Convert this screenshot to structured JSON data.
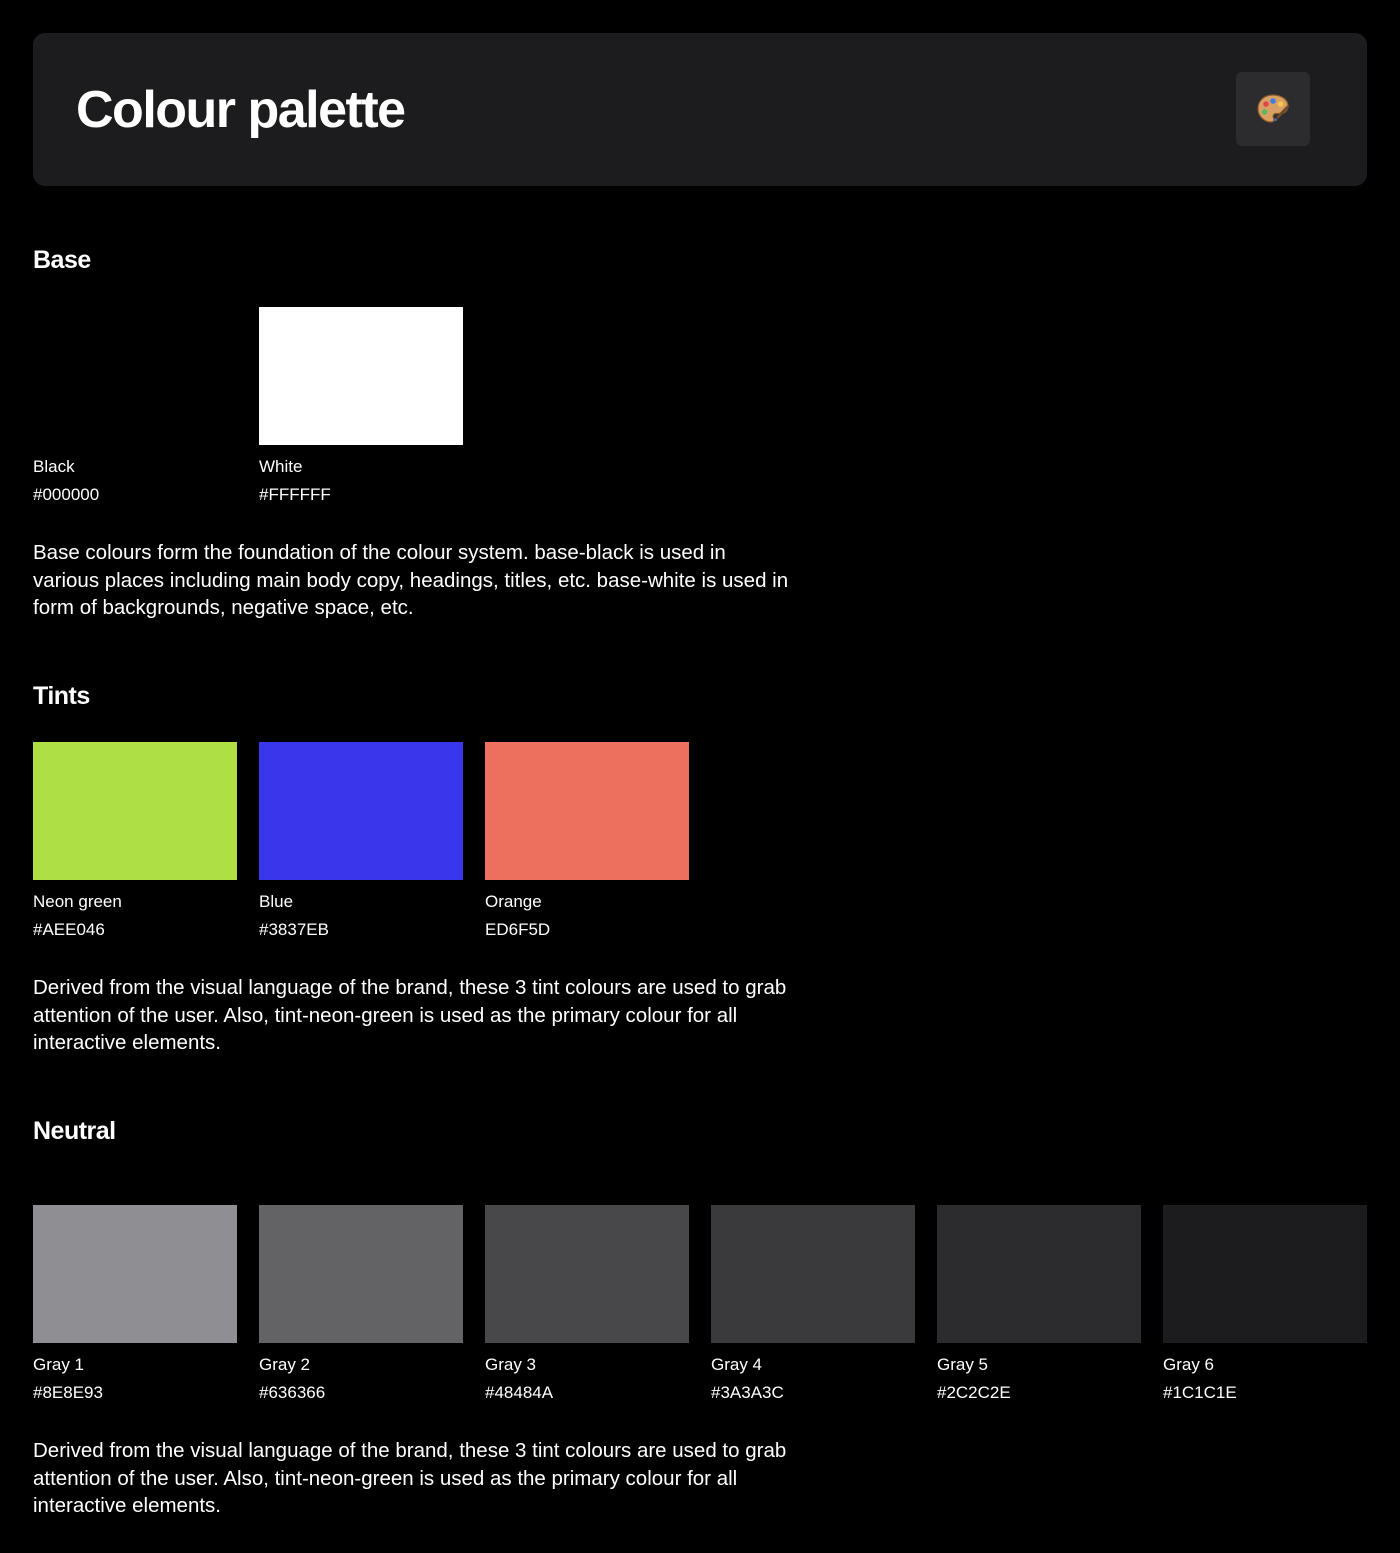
{
  "header": {
    "title": "Colour palette",
    "icon": "palette-icon"
  },
  "sections": {
    "base": {
      "title": "Base",
      "swatches": [
        {
          "name": "Black",
          "hex": "#000000",
          "color": "#000000"
        },
        {
          "name": "White",
          "hex": "#FFFFFF",
          "color": "#FFFFFF"
        }
      ],
      "description": "Base colours form the foundation of the colour system. base-black is used in various places including main body copy, headings, titles, etc. base-white is used in form of backgrounds, negative space, etc."
    },
    "tints": {
      "title": "Tints",
      "swatches": [
        {
          "name": "Neon green",
          "hex": "#AEE046",
          "color": "#AEE046"
        },
        {
          "name": "Blue",
          "hex": "#3837EB",
          "color": "#3837EB"
        },
        {
          "name": "Orange",
          "hex": "ED6F5D",
          "color": "#ED6F5D"
        }
      ],
      "description": "Derived from the visual language of the brand, these 3 tint colours are used to grab attention of the user. Also, tint-neon-green is used as the primary colour for all interactive elements."
    },
    "neutral": {
      "title": "Neutral",
      "swatches": [
        {
          "name": "Gray 1",
          "hex": "#8E8E93",
          "color": "#8E8E93"
        },
        {
          "name": "Gray 2",
          "hex": "#636366",
          "color": "#636366"
        },
        {
          "name": "Gray 3",
          "hex": "#48484A",
          "color": "#48484A"
        },
        {
          "name": "Gray 4",
          "hex": "#3A3A3C",
          "color": "#3A3A3C"
        },
        {
          "name": "Gray 5",
          "hex": "#2C2C2E",
          "color": "#2C2C2E"
        },
        {
          "name": "Gray 6",
          "hex": "#1C1C1E",
          "color": "#1C1C1E"
        }
      ],
      "description": "Derived from the visual language of the brand, these 3 tint colours are used to grab attention of the user. Also, tint-neon-green is used as the primary colour for all interactive elements."
    }
  }
}
